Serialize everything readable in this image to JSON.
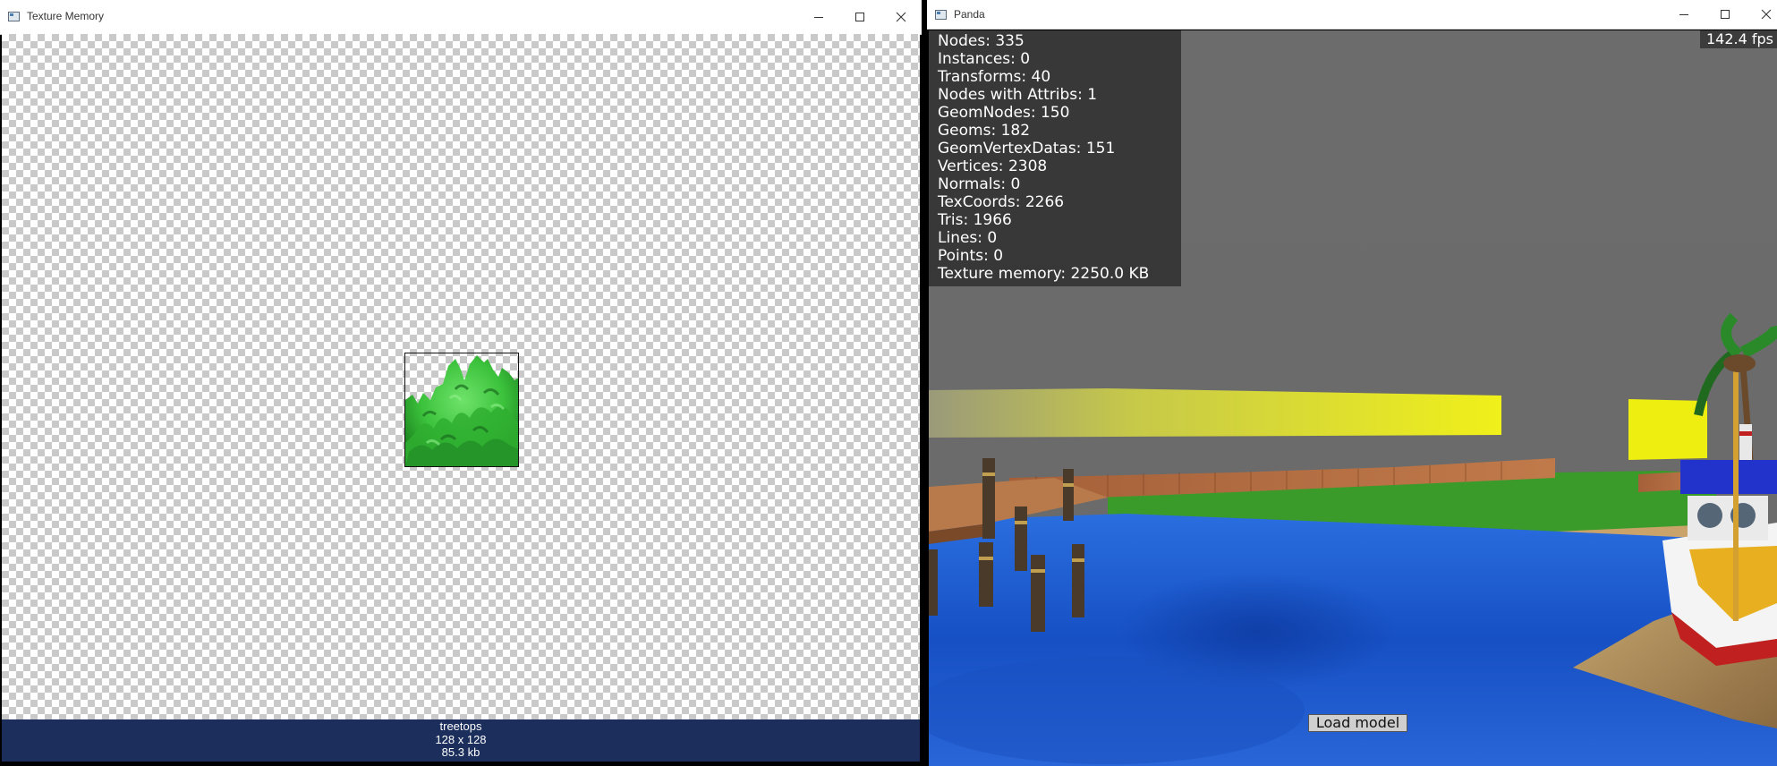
{
  "texture_window": {
    "title": "Texture Memory",
    "texture": {
      "name": "treetops",
      "dimensions": "128 x 128",
      "size": "85.3 kb"
    }
  },
  "panda_window": {
    "title": "Panda",
    "fps": "142.4 fps",
    "stats": [
      "Nodes: 335",
      "Instances: 0",
      "Transforms: 40",
      "Nodes with Attribs: 1",
      "GeomNodes: 150",
      "Geoms: 182",
      "GeomVertexDatas: 151",
      "Vertices: 2308",
      "Normals: 0",
      "TexCoords: 2266",
      "Tris: 1966",
      "Lines: 0",
      "Points: 0",
      "Texture memory: 2250.0 KB"
    ],
    "load_button": "Load model"
  },
  "window_controls": [
    "minimize-icon",
    "maximize-icon",
    "close-icon"
  ],
  "colors": {
    "status_bar": "#1b2e5c",
    "sky": "#6b6b6b",
    "water": "#1f5fd1",
    "grass": "#3a9a2a",
    "stats_bg": "#343434"
  }
}
